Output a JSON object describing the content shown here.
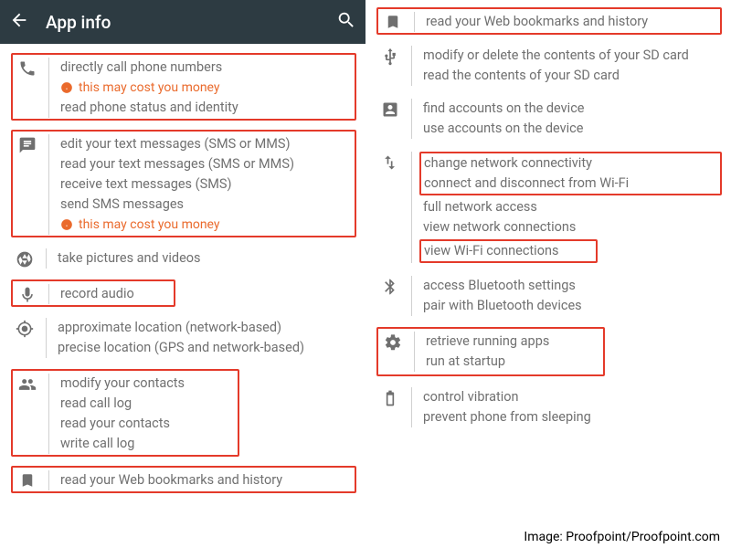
{
  "appbar": {
    "title": "App info"
  },
  "left": {
    "phone": {
      "items": [
        "directly call phone numbers"
      ],
      "warn": "this may cost you money",
      "tail": [
        "read phone status and identity"
      ]
    },
    "sms": {
      "items": [
        "edit your text messages (SMS or MMS)",
        "read your text messages (SMS or MMS)",
        "receive text messages (SMS)",
        "send SMS messages"
      ],
      "warn": "this may cost you money"
    },
    "camera": {
      "items": [
        "take pictures and videos"
      ]
    },
    "mic": {
      "items": [
        "record audio"
      ]
    },
    "location": {
      "items": [
        "approximate location (network-based)",
        "precise location (GPS and network-based)"
      ]
    },
    "contacts": {
      "items": [
        "modify your contacts",
        "read call log",
        "read your contacts",
        "write call log"
      ]
    },
    "bookmarks": {
      "items": [
        "read your Web bookmarks and history"
      ]
    }
  },
  "right": {
    "bookmarks": {
      "items": [
        "read your Web bookmarks and history"
      ]
    },
    "usb": {
      "items": [
        "modify or delete the contents of your SD card",
        "read the contents of your SD card"
      ]
    },
    "accounts": {
      "items": [
        "find accounts on the device",
        "use accounts on the device"
      ]
    },
    "network": {
      "hl1": [
        "change network connectivity",
        "connect and disconnect from Wi-Fi"
      ],
      "mid": [
        "full network access",
        "view network connections"
      ],
      "hl2": [
        "view Wi-Fi connections"
      ]
    },
    "bluetooth": {
      "items": [
        "access Bluetooth settings",
        "pair with Bluetooth devices"
      ]
    },
    "running": {
      "items": [
        "retrieve running apps",
        "run at startup"
      ]
    },
    "battery": {
      "items": [
        "control vibration",
        "prevent phone from sleeping"
      ]
    }
  },
  "credit": "Image: Proofpoint/Proofpoint.com"
}
